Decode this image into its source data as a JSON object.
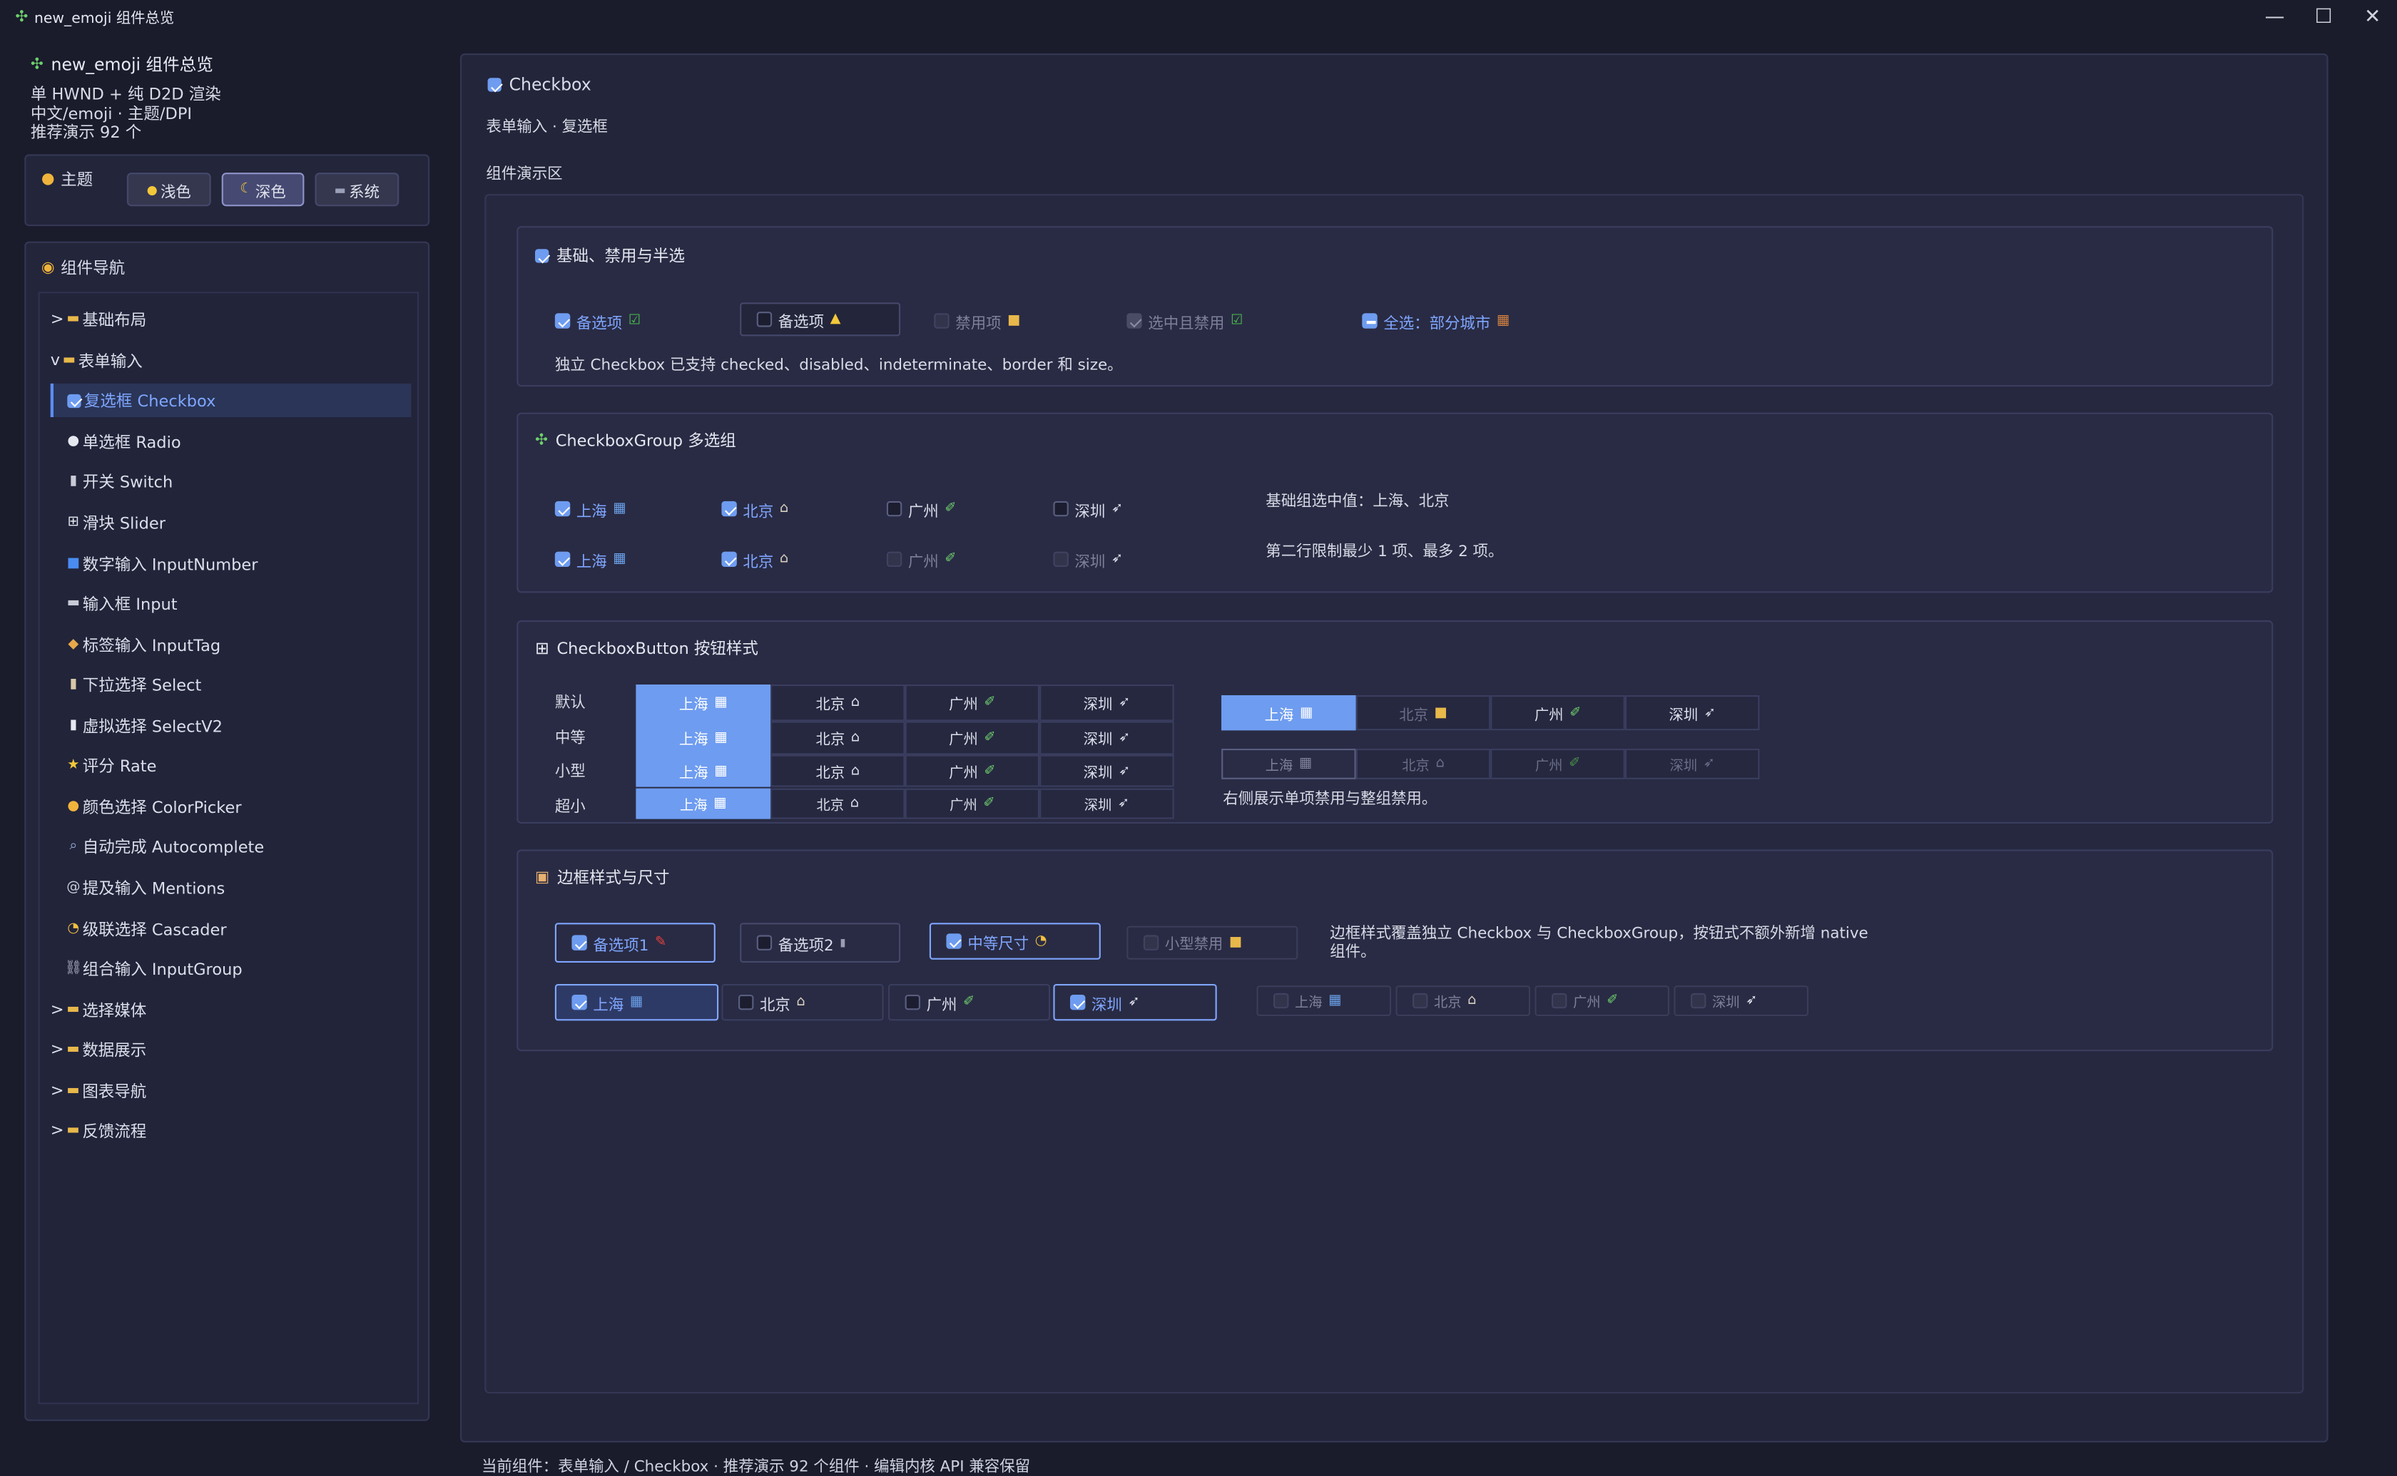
{
  "window": {
    "title": "new_emoji 组件总览",
    "icon": "puzzle-icon"
  },
  "sidebar": {
    "heading": "new_emoji 组件总览",
    "info": [
      "单 HWND + 纯 D2D 渲染",
      "中文/emoji · 主题/DPI",
      "推荐演示 92 个"
    ],
    "theme": {
      "label": "主题",
      "options": [
        "浅色",
        "深色",
        "系统"
      ],
      "selected": "深色"
    },
    "nav_label": "组件导航",
    "nav_items": [
      {
        "label": "基础布局",
        "icon": "folder-icon",
        "prefix": ">"
      },
      {
        "label": "表单输入",
        "icon": "folder-icon",
        "prefix": "v"
      },
      {
        "label": "复选框 Checkbox",
        "icon": "checkbox-icon"
      },
      {
        "label": "单选框 Radio",
        "icon": "radio-icon"
      },
      {
        "label": "开关 Switch",
        "icon": "switch-icon"
      },
      {
        "label": "滑块 Slider",
        "icon": "grid-icon"
      },
      {
        "label": "数字输入 InputNumber",
        "icon": "numbers-icon"
      },
      {
        "label": "输入框 Input",
        "icon": "keyboard-icon"
      },
      {
        "label": "标签输入 InputTag",
        "icon": "tag-icon"
      },
      {
        "label": "下拉选择 Select",
        "icon": "clipboard-icon"
      },
      {
        "label": "虚拟选择 SelectV2",
        "icon": "page-icon"
      },
      {
        "label": "评分 Rate",
        "icon": "star-icon"
      },
      {
        "label": "颜色选择 ColorPicker",
        "icon": "palette-icon"
      },
      {
        "label": "自动完成 Autocomplete",
        "icon": "magnifier-icon"
      },
      {
        "label": "提及输入 Mentions",
        "icon": "at-icon"
      },
      {
        "label": "级联选择 Cascader",
        "icon": "clock-icon"
      },
      {
        "label": "组合输入 InputGroup",
        "icon": "link-icon"
      },
      {
        "label": "选择媒体",
        "icon": "folder-icon",
        "prefix": ">"
      },
      {
        "label": "数据展示",
        "icon": "folder-icon",
        "prefix": ">"
      },
      {
        "label": "图表导航",
        "icon": "folder-icon",
        "prefix": ">"
      },
      {
        "label": "反馈流程",
        "icon": "folder-icon",
        "prefix": ">"
      }
    ]
  },
  "main": {
    "title": "Checkbox",
    "subtitle": "表单输入 · 复选框",
    "demo_label": "组件演示区",
    "sec1": {
      "title": "基础、禁用与半选",
      "opts": [
        "备选项",
        "备选项",
        "禁用项",
        "选中且禁用",
        "全选：部分城市"
      ],
      "desc": "独立 Checkbox 已支持 checked、disabled、indeterminate、border 和 size。"
    },
    "sec2": {
      "title": "CheckboxGroup 多选组",
      "cities": [
        "上海",
        "北京",
        "广州",
        "深圳"
      ],
      "note1": "基础组选中值：上海、北京",
      "note2": "第二行限制最少 1 项、最多 2 项。"
    },
    "sec3": {
      "title": "CheckboxButton 按钮样式",
      "sizes": [
        "默认",
        "中等",
        "小型",
        "超小"
      ],
      "cities": [
        "上海",
        "北京",
        "广州",
        "深圳"
      ],
      "note": "右侧展示单项禁用与整组禁用。"
    },
    "sec4": {
      "title": "边框样式与尺寸",
      "opts": [
        "备选项1",
        "备选项2",
        "中等尺寸",
        "小型禁用"
      ],
      "cities": [
        "上海",
        "北京",
        "广州",
        "深圳"
      ],
      "note": "边框样式覆盖独立 Checkbox 与 CheckboxGroup，按钮式不额外新增 native 组件。"
    }
  },
  "status_bar": "当前组件：表单输入 / Checkbox · 推荐演示 92 个组件 · 编辑内核 API 兼容保留",
  "colors": {
    "accent": "#6e9cf0",
    "background": "#1a1c2c",
    "panel": "#23253a"
  }
}
